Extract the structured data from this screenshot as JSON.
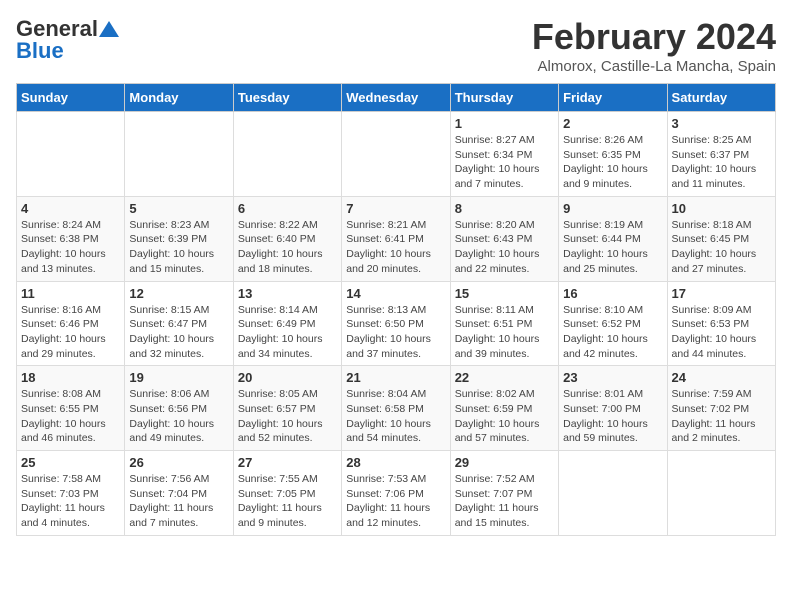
{
  "logo": {
    "general": "General",
    "blue": "Blue"
  },
  "title": {
    "month": "February 2024",
    "location": "Almorox, Castille-La Mancha, Spain"
  },
  "weekdays": [
    "Sunday",
    "Monday",
    "Tuesday",
    "Wednesday",
    "Thursday",
    "Friday",
    "Saturday"
  ],
  "weeks": [
    [
      {
        "day": "",
        "info": ""
      },
      {
        "day": "",
        "info": ""
      },
      {
        "day": "",
        "info": ""
      },
      {
        "day": "",
        "info": ""
      },
      {
        "day": "1",
        "info": "Sunrise: 8:27 AM\nSunset: 6:34 PM\nDaylight: 10 hours\nand 7 minutes."
      },
      {
        "day": "2",
        "info": "Sunrise: 8:26 AM\nSunset: 6:35 PM\nDaylight: 10 hours\nand 9 minutes."
      },
      {
        "day": "3",
        "info": "Sunrise: 8:25 AM\nSunset: 6:37 PM\nDaylight: 10 hours\nand 11 minutes."
      }
    ],
    [
      {
        "day": "4",
        "info": "Sunrise: 8:24 AM\nSunset: 6:38 PM\nDaylight: 10 hours\nand 13 minutes."
      },
      {
        "day": "5",
        "info": "Sunrise: 8:23 AM\nSunset: 6:39 PM\nDaylight: 10 hours\nand 15 minutes."
      },
      {
        "day": "6",
        "info": "Sunrise: 8:22 AM\nSunset: 6:40 PM\nDaylight: 10 hours\nand 18 minutes."
      },
      {
        "day": "7",
        "info": "Sunrise: 8:21 AM\nSunset: 6:41 PM\nDaylight: 10 hours\nand 20 minutes."
      },
      {
        "day": "8",
        "info": "Sunrise: 8:20 AM\nSunset: 6:43 PM\nDaylight: 10 hours\nand 22 minutes."
      },
      {
        "day": "9",
        "info": "Sunrise: 8:19 AM\nSunset: 6:44 PM\nDaylight: 10 hours\nand 25 minutes."
      },
      {
        "day": "10",
        "info": "Sunrise: 8:18 AM\nSunset: 6:45 PM\nDaylight: 10 hours\nand 27 minutes."
      }
    ],
    [
      {
        "day": "11",
        "info": "Sunrise: 8:16 AM\nSunset: 6:46 PM\nDaylight: 10 hours\nand 29 minutes."
      },
      {
        "day": "12",
        "info": "Sunrise: 8:15 AM\nSunset: 6:47 PM\nDaylight: 10 hours\nand 32 minutes."
      },
      {
        "day": "13",
        "info": "Sunrise: 8:14 AM\nSunset: 6:49 PM\nDaylight: 10 hours\nand 34 minutes."
      },
      {
        "day": "14",
        "info": "Sunrise: 8:13 AM\nSunset: 6:50 PM\nDaylight: 10 hours\nand 37 minutes."
      },
      {
        "day": "15",
        "info": "Sunrise: 8:11 AM\nSunset: 6:51 PM\nDaylight: 10 hours\nand 39 minutes."
      },
      {
        "day": "16",
        "info": "Sunrise: 8:10 AM\nSunset: 6:52 PM\nDaylight: 10 hours\nand 42 minutes."
      },
      {
        "day": "17",
        "info": "Sunrise: 8:09 AM\nSunset: 6:53 PM\nDaylight: 10 hours\nand 44 minutes."
      }
    ],
    [
      {
        "day": "18",
        "info": "Sunrise: 8:08 AM\nSunset: 6:55 PM\nDaylight: 10 hours\nand 46 minutes."
      },
      {
        "day": "19",
        "info": "Sunrise: 8:06 AM\nSunset: 6:56 PM\nDaylight: 10 hours\nand 49 minutes."
      },
      {
        "day": "20",
        "info": "Sunrise: 8:05 AM\nSunset: 6:57 PM\nDaylight: 10 hours\nand 52 minutes."
      },
      {
        "day": "21",
        "info": "Sunrise: 8:04 AM\nSunset: 6:58 PM\nDaylight: 10 hours\nand 54 minutes."
      },
      {
        "day": "22",
        "info": "Sunrise: 8:02 AM\nSunset: 6:59 PM\nDaylight: 10 hours\nand 57 minutes."
      },
      {
        "day": "23",
        "info": "Sunrise: 8:01 AM\nSunset: 7:00 PM\nDaylight: 10 hours\nand 59 minutes."
      },
      {
        "day": "24",
        "info": "Sunrise: 7:59 AM\nSunset: 7:02 PM\nDaylight: 11 hours\nand 2 minutes."
      }
    ],
    [
      {
        "day": "25",
        "info": "Sunrise: 7:58 AM\nSunset: 7:03 PM\nDaylight: 11 hours\nand 4 minutes."
      },
      {
        "day": "26",
        "info": "Sunrise: 7:56 AM\nSunset: 7:04 PM\nDaylight: 11 hours\nand 7 minutes."
      },
      {
        "day": "27",
        "info": "Sunrise: 7:55 AM\nSunset: 7:05 PM\nDaylight: 11 hours\nand 9 minutes."
      },
      {
        "day": "28",
        "info": "Sunrise: 7:53 AM\nSunset: 7:06 PM\nDaylight: 11 hours\nand 12 minutes."
      },
      {
        "day": "29",
        "info": "Sunrise: 7:52 AM\nSunset: 7:07 PM\nDaylight: 11 hours\nand 15 minutes."
      },
      {
        "day": "",
        "info": ""
      },
      {
        "day": "",
        "info": ""
      }
    ]
  ]
}
